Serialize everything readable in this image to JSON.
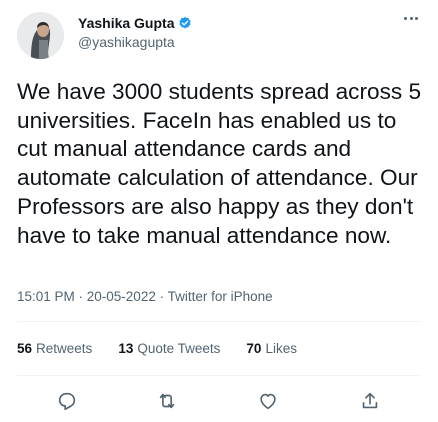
{
  "author": {
    "name": "Yashika Gupta",
    "handle": "@yashikagupta",
    "verified": true,
    "avatar_icon": "user-avatar"
  },
  "tweet": {
    "text": "We have 3000 students spread across 5 universities. FaceIn has enabled us to cut manual attendance cards and automate calculation of attendance. Our Professors are also happy as they don't have to take manual attendance now."
  },
  "meta": {
    "line": "15:01 PM · 20-05-2022 · Twitter for iPhone"
  },
  "stats": {
    "retweets_count": "56",
    "retweets_label": "Retweets",
    "quotes_count": "13",
    "quotes_label": "Quote Tweets",
    "likes_count": "70",
    "likes_label": "Likes"
  },
  "actions": {
    "reply_icon": "reply-icon",
    "retweet_icon": "retweet-icon",
    "like_icon": "like-icon",
    "share_icon": "share-icon"
  },
  "colors": {
    "text": "#0f1419",
    "secondary": "#536471",
    "verified": "#1d9bf0",
    "divider": "#eff3f4"
  }
}
